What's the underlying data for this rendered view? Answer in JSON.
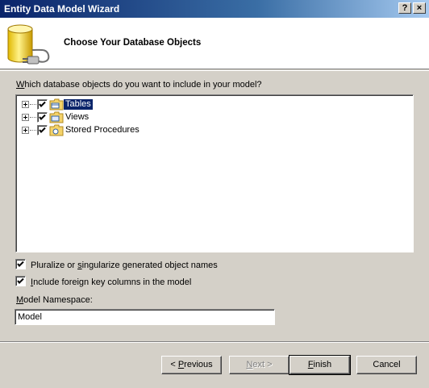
{
  "window": {
    "title": "Entity Data Model Wizard",
    "help_glyph": "?",
    "close_glyph": "×"
  },
  "header": {
    "heading": "Choose Your Database Objects"
  },
  "prompt": {
    "before": "",
    "mnemonic": "W",
    "after": "hich database objects do you want to include in your model?"
  },
  "tree": {
    "items": [
      {
        "label": "Tables",
        "checked": true,
        "expanded": false,
        "selected": true
      },
      {
        "label": "Views",
        "checked": true,
        "expanded": false,
        "selected": false
      },
      {
        "label": "Stored Procedures",
        "checked": true,
        "expanded": false,
        "selected": false
      }
    ]
  },
  "options": {
    "pluralize": {
      "before": "Pluralize or ",
      "mnemonic": "s",
      "after": "ingularize generated object names",
      "checked": true
    },
    "foreign_keys": {
      "before": "",
      "mnemonic": "I",
      "after": "nclude foreign key columns in the model",
      "checked": true
    }
  },
  "namespace": {
    "label_before": "",
    "label_mnemonic": "M",
    "label_after": "odel Namespace:",
    "value": "Model"
  },
  "buttons": {
    "previous": {
      "before": "< ",
      "mnemonic": "P",
      "after": "revious"
    },
    "next": {
      "before": "",
      "mnemonic": "N",
      "after": "ext >"
    },
    "finish": {
      "before": "",
      "mnemonic": "F",
      "after": "inish"
    },
    "cancel": {
      "label": "Cancel"
    }
  },
  "colors": {
    "selection": "#0a246a",
    "titlebar_start": "#0a246a",
    "titlebar_end": "#a6caf0",
    "dialog_face": "#d4d0c8"
  }
}
